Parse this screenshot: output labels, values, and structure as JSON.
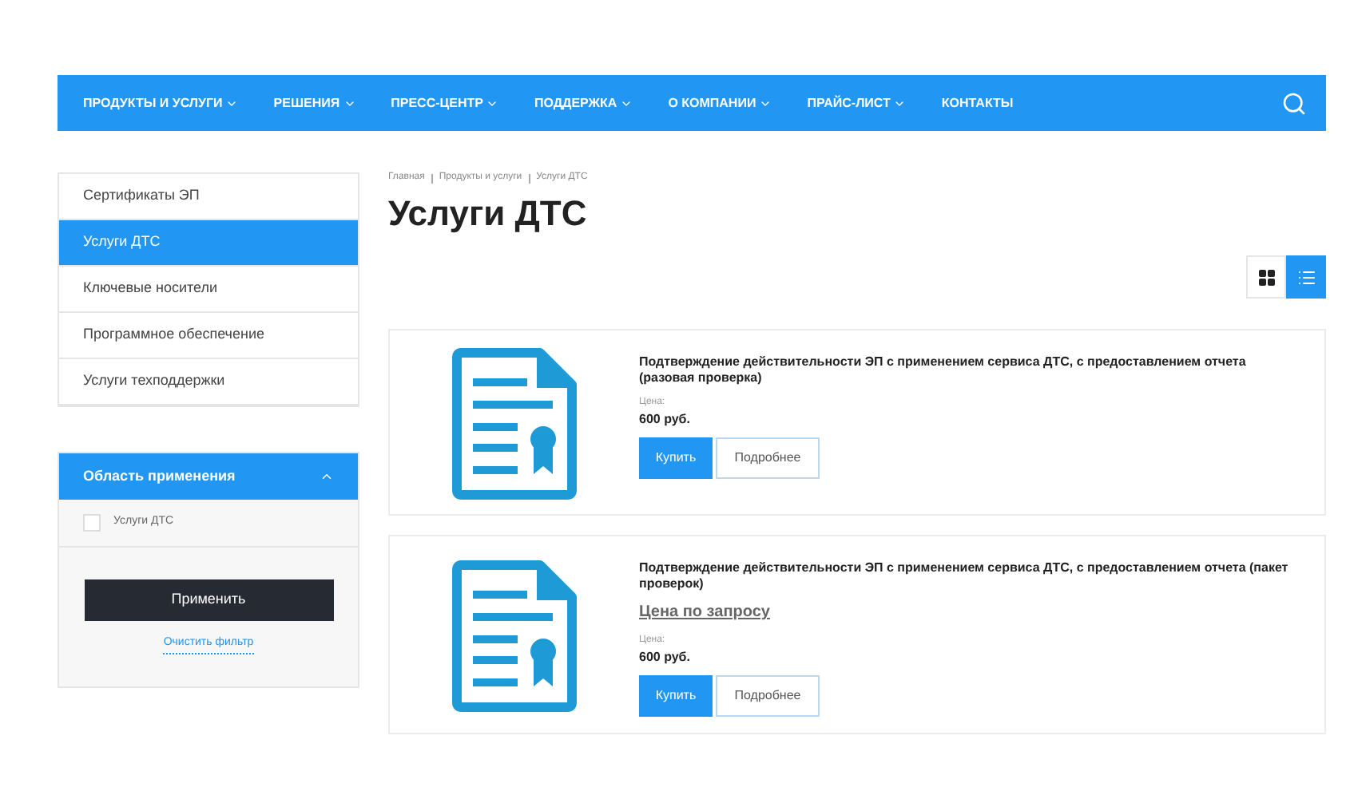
{
  "nav": {
    "items": [
      {
        "label": "ПРОДУКТЫ И УСЛУГИ",
        "dropdown": true
      },
      {
        "label": "РЕШЕНИЯ",
        "dropdown": true
      },
      {
        "label": "ПРЕСС-ЦЕНТР",
        "dropdown": true
      },
      {
        "label": "ПОДДЕРЖКА",
        "dropdown": true
      },
      {
        "label": "О КОМПАНИИ",
        "dropdown": true
      },
      {
        "label": "ПРАЙС-ЛИСТ",
        "dropdown": true
      },
      {
        "label": "КОНТАКТЫ",
        "dropdown": false
      }
    ]
  },
  "sidebar": {
    "items": [
      {
        "label": "Сертификаты ЭП",
        "selected": false
      },
      {
        "label": "Услуги ДТС",
        "selected": true
      },
      {
        "label": "Ключевые носители",
        "selected": false
      },
      {
        "label": "Программное обеспечение",
        "selected": false
      },
      {
        "label": "Услуги техподдержки",
        "selected": false
      }
    ]
  },
  "filter": {
    "title": "Область применения",
    "expanded": true,
    "options": [
      {
        "label": "Услуги ДТС",
        "checked": false
      }
    ],
    "apply": "Применить",
    "clear": "Очистить фильтр"
  },
  "breadcrumbs": [
    "Главная",
    "Продукты и услуги",
    "Услуги ДТС"
  ],
  "title": "Услуги ДТС",
  "view_toggle": [
    {
      "kind": "grid",
      "selected": false
    },
    {
      "kind": "list",
      "selected": true
    }
  ],
  "products": [
    {
      "title": "Подтверждение действительности ЭП с применением сервиса ДТС, с предоставлением отчета (разовая проверка)",
      "price_label": "Цена:",
      "price": "600 руб.",
      "buy": "Купить",
      "details": "Подробнее"
    },
    {
      "title": "Подтверждение действительности ЭП с применением сервиса ДТС, с предоставлением отчета (пакет проверок)",
      "request_link": "Цена по запросу",
      "price_label": "Цена:",
      "price": "600 руб.",
      "buy": "Купить",
      "details": "Подробнее"
    }
  ]
}
